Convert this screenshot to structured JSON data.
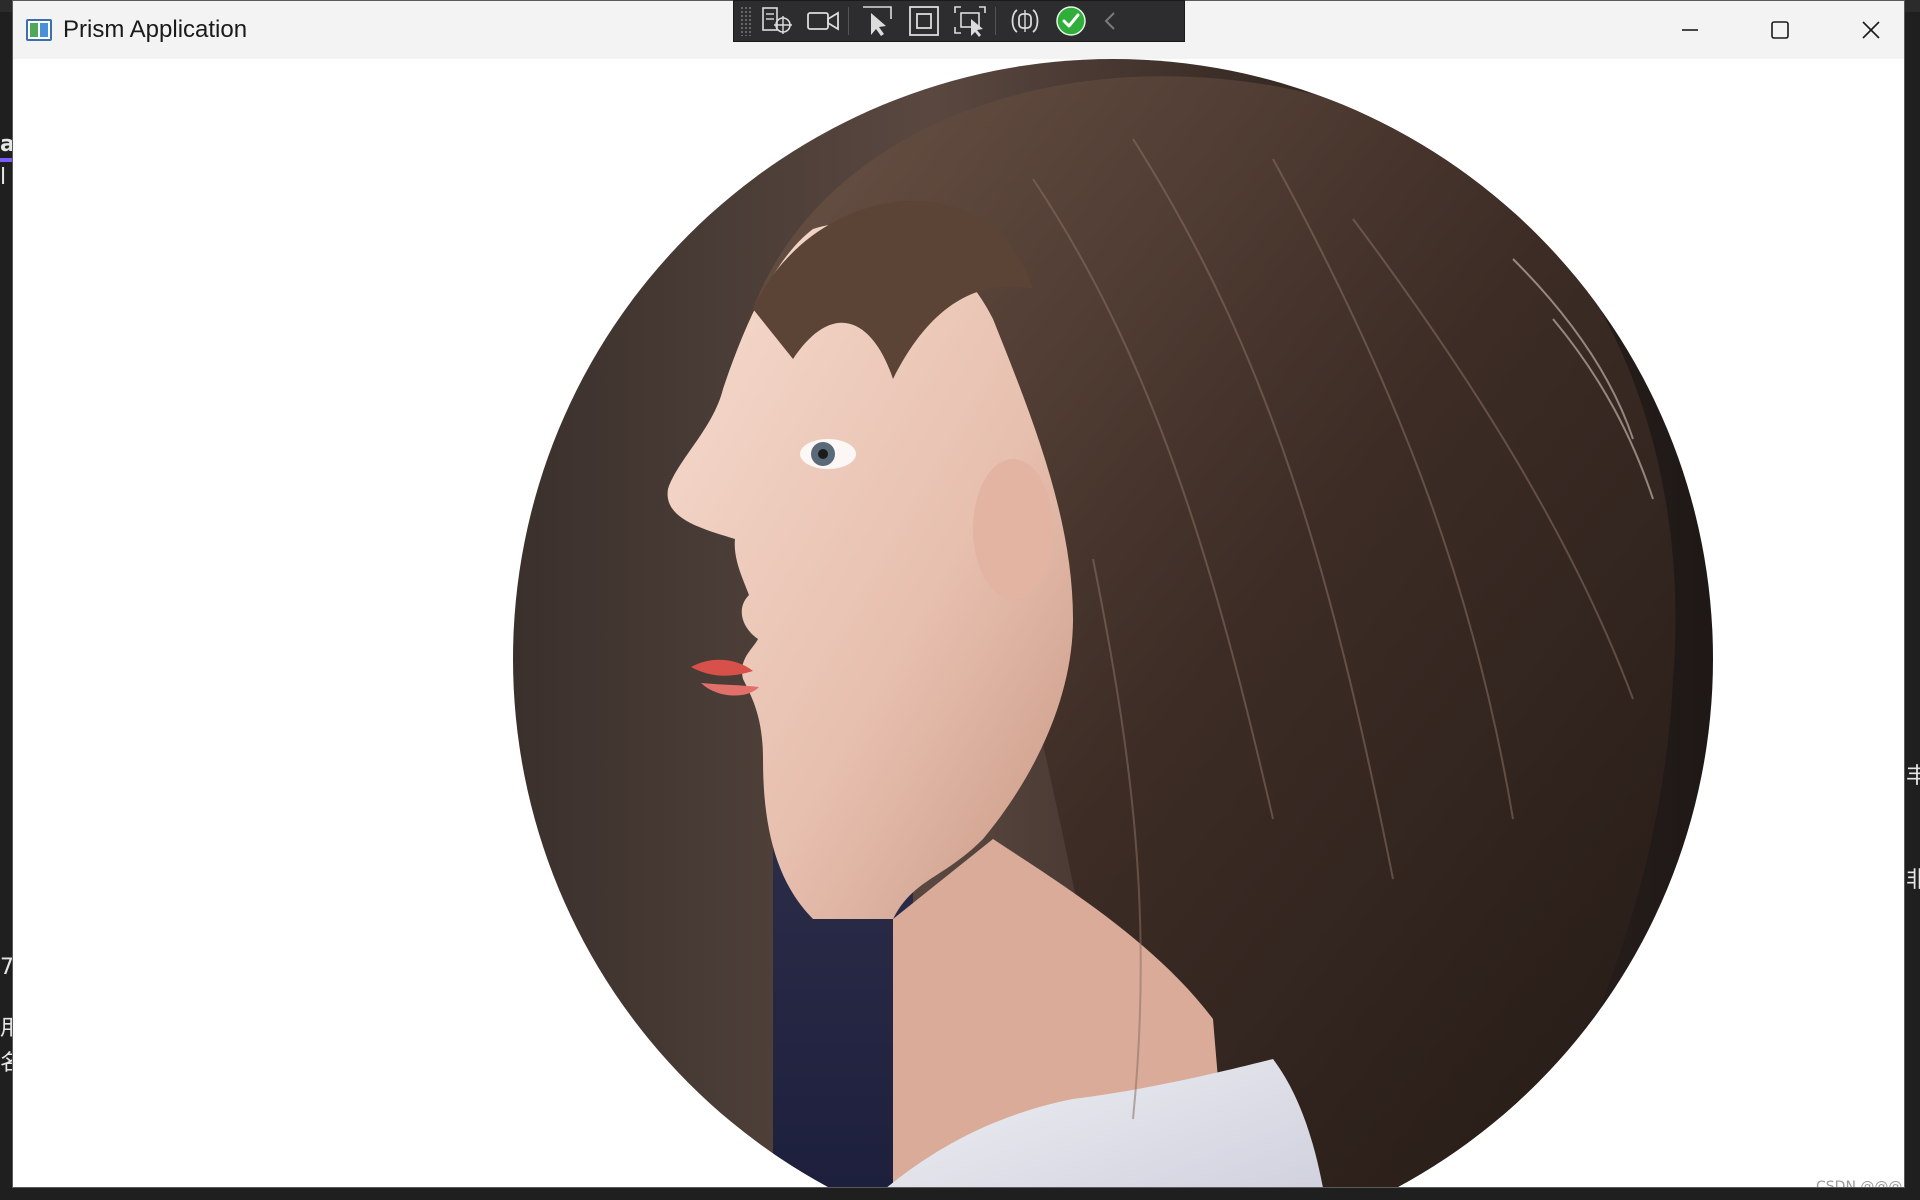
{
  "window": {
    "title": "Prism Application",
    "icon": "app-window-icon"
  },
  "titlebar_buttons": {
    "minimize": "minimize-icon",
    "maximize": "maximize-icon",
    "close": "close-icon"
  },
  "debug_toolbar": {
    "items": [
      "select-element-icon",
      "record-icon",
      "select-pointer-icon",
      "layout-adorner-icon",
      "track-focus-icon",
      "binding-failures-icon",
      "check-status-icon",
      "collapse-chevron-icon"
    ],
    "status_color": "#2fae3a"
  },
  "content": {
    "image": "circular-portrait-image",
    "image_subject": "profile-portrait-photo"
  },
  "background_app": {
    "left_fragments": [
      "a",
      "l V",
      "7",
      "用",
      "名"
    ],
    "right_fragments": [
      "丰",
      "非"
    ]
  },
  "watermark": {
    "text": "CSDN @@@小何"
  }
}
